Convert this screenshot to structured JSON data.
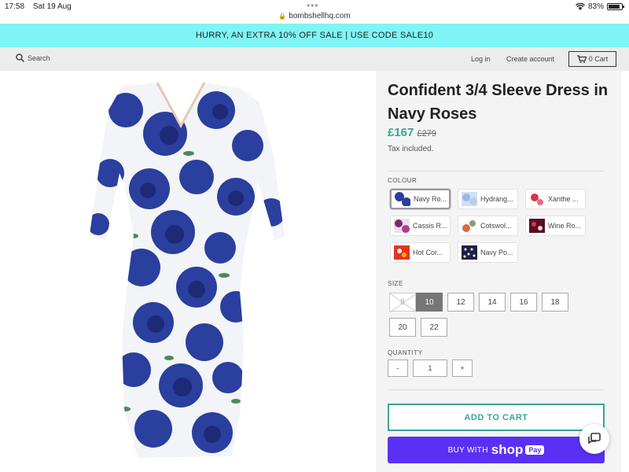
{
  "status_bar": {
    "time": "17:58",
    "date": "Sat 19 Aug",
    "url": "bombshellhq.com",
    "battery": "83%"
  },
  "promo": {
    "text": "HURRY, AN EXTRA 10% OFF SALE | USE CODE SALE10",
    "background": "#7ff4f4"
  },
  "header": {
    "search_label": "Search",
    "login_label": "Log in",
    "create_account_label": "Create account",
    "cart_label": "0 Cart"
  },
  "product": {
    "title": "Confident 3/4 Sleeve Dress in Navy Roses",
    "price": "£167",
    "compare_price": "£279",
    "tax_note": "Tax included.",
    "price_color": "#3aa39d"
  },
  "colour": {
    "label": "COLOUR",
    "options": [
      {
        "label": "Navy Ro...",
        "selected": true
      },
      {
        "label": "Hydrang...",
        "selected": false
      },
      {
        "label": "Xanthe ...",
        "selected": false
      },
      {
        "label": "Cassis R...",
        "selected": false
      },
      {
        "label": "Cotswol...",
        "selected": false
      },
      {
        "label": "Wine Ro...",
        "selected": false
      },
      {
        "label": "Hot Cor...",
        "selected": false
      },
      {
        "label": "Navy Po...",
        "selected": false
      }
    ]
  },
  "size": {
    "label": "SIZE",
    "options": [
      {
        "label": "8",
        "state": "unavailable"
      },
      {
        "label": "10",
        "state": "selected"
      },
      {
        "label": "12",
        "state": "available"
      },
      {
        "label": "14",
        "state": "available"
      },
      {
        "label": "16",
        "state": "available"
      },
      {
        "label": "18",
        "state": "available"
      },
      {
        "label": "20",
        "state": "available"
      },
      {
        "label": "22",
        "state": "available"
      }
    ]
  },
  "quantity": {
    "label": "QUANTITY",
    "minus": "-",
    "value": "1",
    "plus": "+"
  },
  "actions": {
    "add_to_cart": "ADD TO CART",
    "buy_with": "BUY WITH",
    "shop_word": "shop",
    "pay_word": "Pay",
    "shop_pay_color": "#5a31f4"
  }
}
